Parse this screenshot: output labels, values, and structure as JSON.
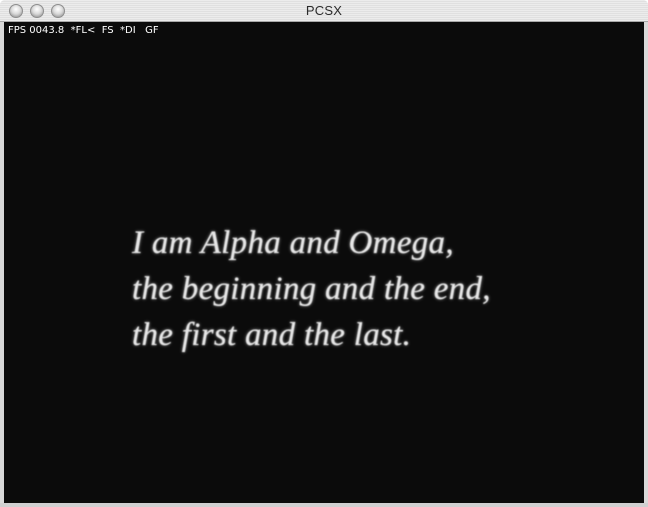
{
  "window": {
    "title": "PCSX"
  },
  "osd": {
    "status_text": "FPS 0043.8  *FL<  FS  *DI   GF"
  },
  "screen": {
    "verse_lines": [
      "I am Alpha and Omega,",
      "the beginning and the end,",
      "the first and the last."
    ]
  },
  "colors": {
    "screen_background": "#0b0b0b",
    "text": "#e6e6e6"
  }
}
